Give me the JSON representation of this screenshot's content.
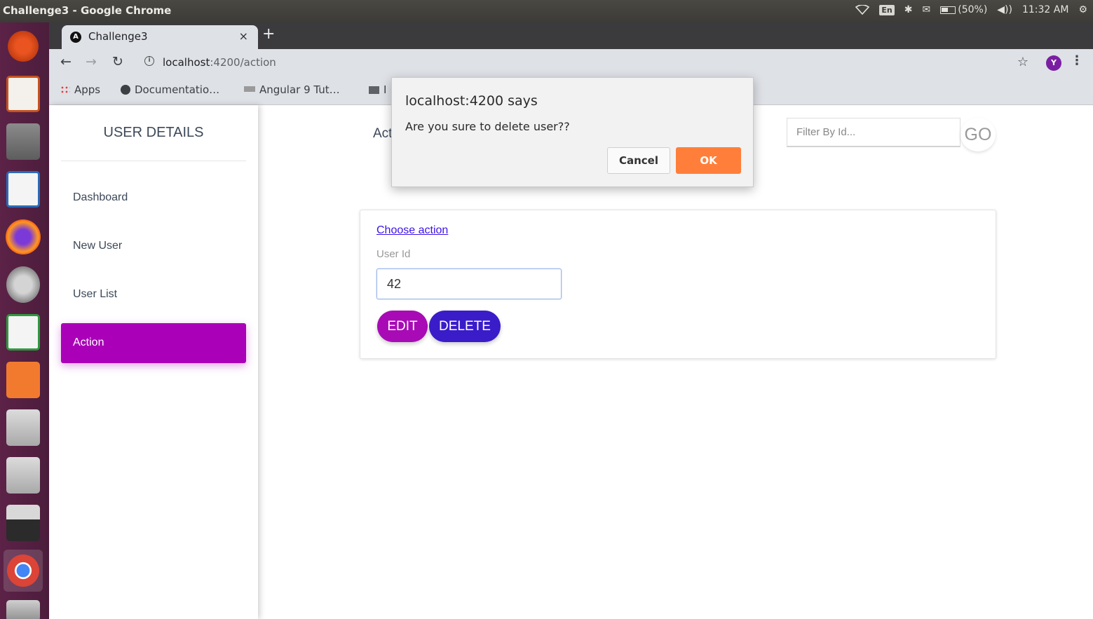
{
  "os": {
    "window_title": "Challenge3 - Google Chrome",
    "keyboard_layout": "En",
    "battery": "(50%)",
    "clock": "11:32 AM"
  },
  "launcher": {
    "apps": [
      "ubuntu-dash",
      "libreoffice-impress",
      "files",
      "libreoffice-writer",
      "firefox",
      "system-settings",
      "libreoffice-calc",
      "ubuntu-software",
      "disk-drive",
      "disk-drive",
      "scanner-terminal",
      "google-chrome",
      "trash"
    ]
  },
  "browser": {
    "tab_title": "Challenge3",
    "tab_close": "×",
    "new_tab": "+",
    "url_host": "localhost",
    "url_path": ":4200/action",
    "bookmarks": [
      "Apps",
      "Documentatio…",
      "Angular 9 Tut…",
      "I"
    ],
    "profile_initial": "Y"
  },
  "sidebar": {
    "brand": "USER DETAILS",
    "items": [
      {
        "label": "Dashboard"
      },
      {
        "label": "New User"
      },
      {
        "label": "User List"
      },
      {
        "label": "Action"
      }
    ]
  },
  "header": {
    "page_title": "Act",
    "filter_placeholder": "Filter By Id...",
    "go_label": "GO"
  },
  "card": {
    "link": "Choose action",
    "user_id_label": "User Id",
    "user_id_value": "42",
    "edit_label": "EDIT",
    "delete_label": "DELETE"
  },
  "dialog": {
    "title": "localhost:4200 says",
    "message": "Are you sure to delete user??",
    "cancel_label": "Cancel",
    "ok_label": "OK"
  },
  "colors": {
    "sidebar_active": "#aa00b8",
    "edit_button": "#a80bb5",
    "delete_button": "#3a1cc9",
    "dialog_ok": "#ff7f3a",
    "launcher": "#5c2247"
  }
}
